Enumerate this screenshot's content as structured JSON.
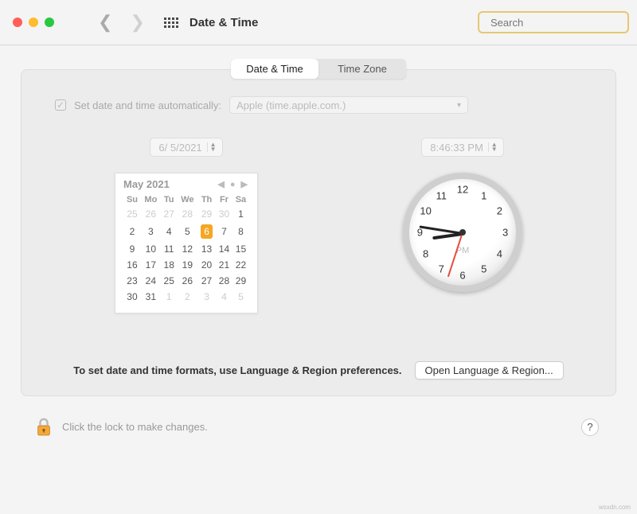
{
  "header": {
    "title": "Date & Time",
    "search_placeholder": "Search"
  },
  "tabs": [
    {
      "label": "Date & Time",
      "active": true
    },
    {
      "label": "Time Zone",
      "active": false
    }
  ],
  "autoset": {
    "label": "Set date and time automatically:",
    "checked": true,
    "server": "Apple (time.apple.com.)"
  },
  "date_field": "6/  5/2021",
  "time_field": "8:46:33 PM",
  "calendar": {
    "title": "May 2021",
    "dow": [
      "Su",
      "Mo",
      "Tu",
      "We",
      "Th",
      "Fr",
      "Sa"
    ],
    "weeks": [
      [
        {
          "d": "25",
          "dim": true
        },
        {
          "d": "26",
          "dim": true
        },
        {
          "d": "27",
          "dim": true
        },
        {
          "d": "28",
          "dim": true
        },
        {
          "d": "29",
          "dim": true
        },
        {
          "d": "30",
          "dim": true
        },
        {
          "d": "1"
        }
      ],
      [
        {
          "d": "2"
        },
        {
          "d": "3"
        },
        {
          "d": "4"
        },
        {
          "d": "5"
        },
        {
          "d": "6",
          "today": true
        },
        {
          "d": "7"
        },
        {
          "d": "8"
        }
      ],
      [
        {
          "d": "9"
        },
        {
          "d": "10"
        },
        {
          "d": "11"
        },
        {
          "d": "12"
        },
        {
          "d": "13"
        },
        {
          "d": "14"
        },
        {
          "d": "15"
        }
      ],
      [
        {
          "d": "16"
        },
        {
          "d": "17"
        },
        {
          "d": "18"
        },
        {
          "d": "19"
        },
        {
          "d": "20"
        },
        {
          "d": "21"
        },
        {
          "d": "22"
        }
      ],
      [
        {
          "d": "23"
        },
        {
          "d": "24"
        },
        {
          "d": "25"
        },
        {
          "d": "26"
        },
        {
          "d": "27"
        },
        {
          "d": "28"
        },
        {
          "d": "29"
        }
      ],
      [
        {
          "d": "30"
        },
        {
          "d": "31"
        },
        {
          "d": "1",
          "dim": true
        },
        {
          "d": "2",
          "dim": true
        },
        {
          "d": "3",
          "dim": true
        },
        {
          "d": "4",
          "dim": true
        },
        {
          "d": "5",
          "dim": true
        }
      ]
    ]
  },
  "clock": {
    "ampm": "PM",
    "hour_angle": 172,
    "minute_angle": 189,
    "second_angle": 108,
    "numbers": [
      "12",
      "1",
      "2",
      "3",
      "4",
      "5",
      "6",
      "7",
      "8",
      "9",
      "10",
      "11"
    ]
  },
  "footer": {
    "text": "To set date and time formats, use Language & Region preferences.",
    "button": "Open Language & Region..."
  },
  "lock": {
    "label": "Click the lock to make changes."
  },
  "watermark": "wsxdn.com"
}
